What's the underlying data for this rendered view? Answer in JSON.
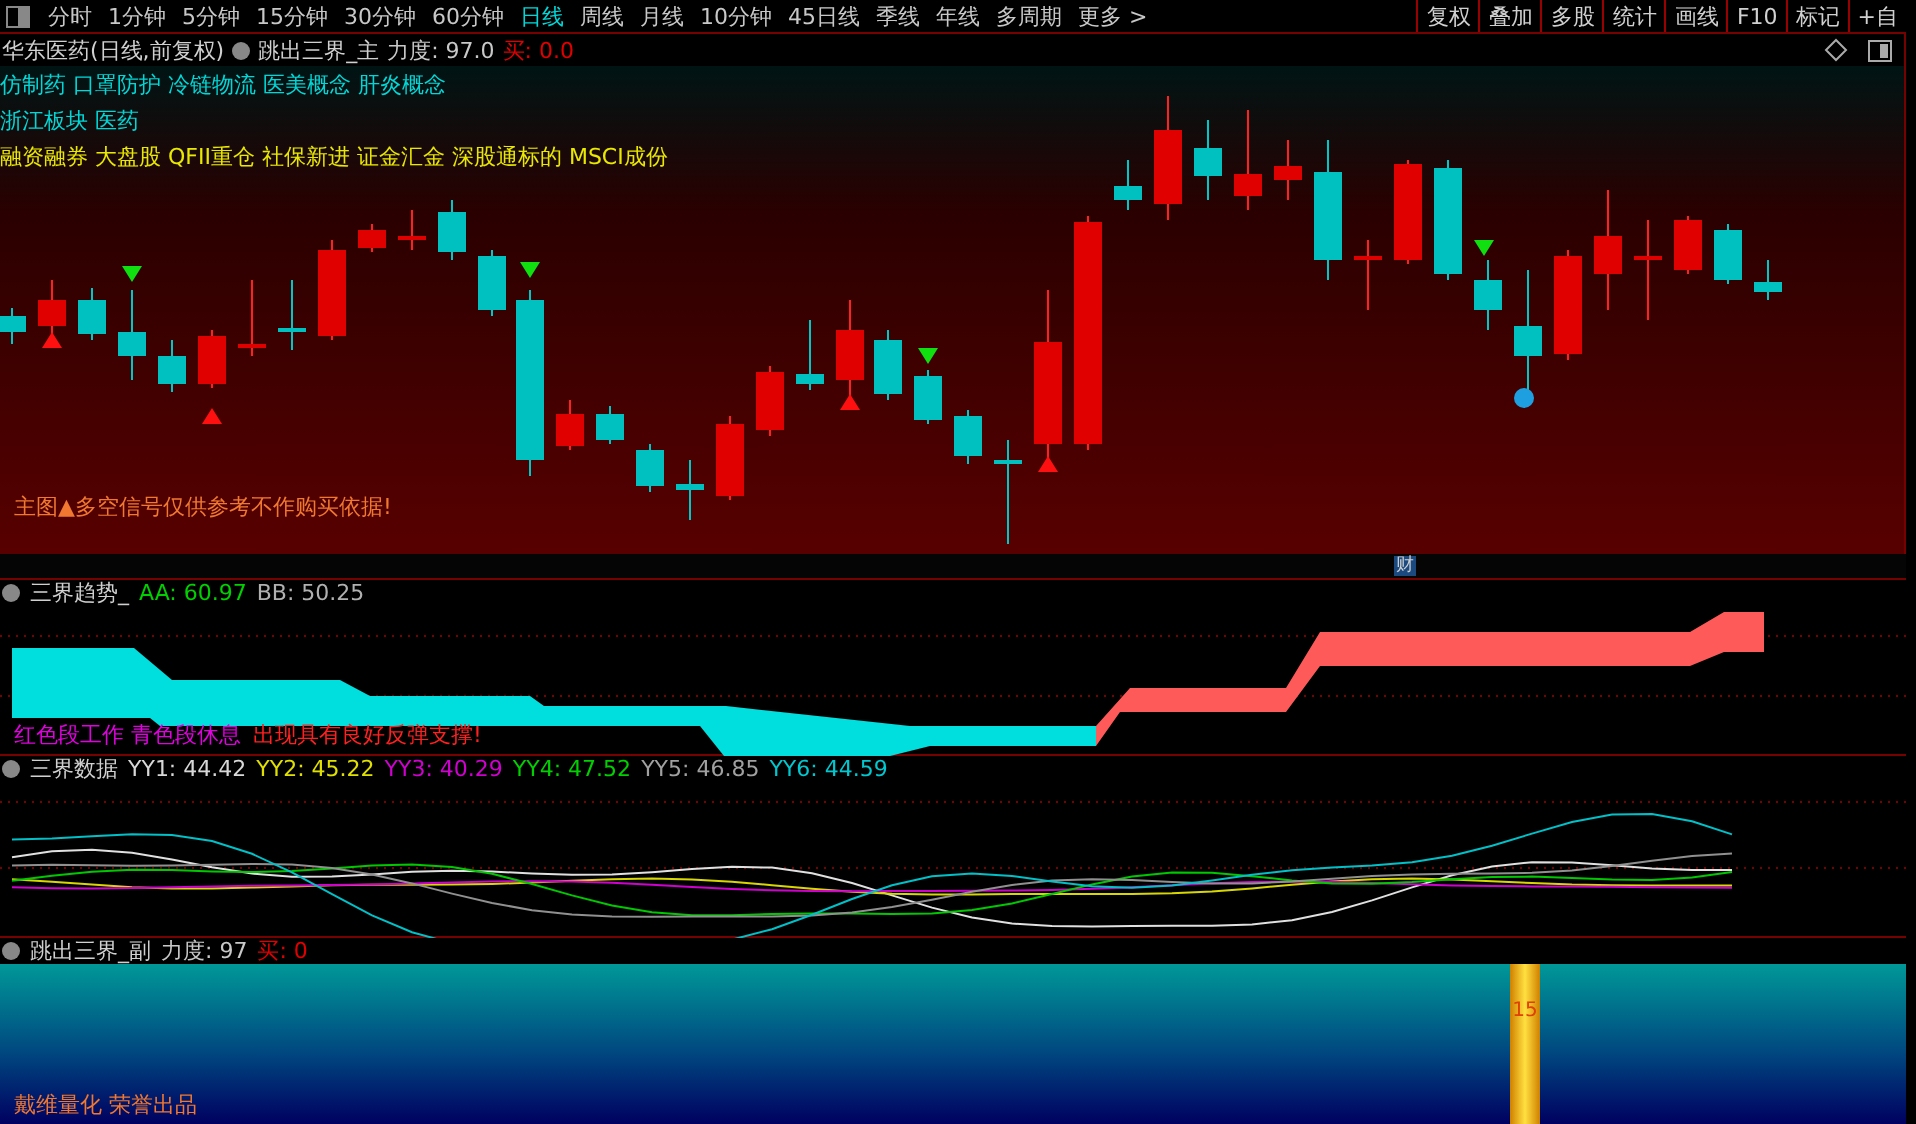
{
  "toolbar": {
    "periods": [
      {
        "label": "分时",
        "selected": false
      },
      {
        "label": "1分钟",
        "selected": false
      },
      {
        "label": "5分钟",
        "selected": false
      },
      {
        "label": "15分钟",
        "selected": false
      },
      {
        "label": "30分钟",
        "selected": false
      },
      {
        "label": "60分钟",
        "selected": false
      },
      {
        "label": "日线",
        "selected": true
      },
      {
        "label": "周线",
        "selected": false
      },
      {
        "label": "月线",
        "selected": false
      },
      {
        "label": "10分钟",
        "selected": false
      },
      {
        "label": "45日线",
        "selected": false
      },
      {
        "label": "季线",
        "selected": false
      },
      {
        "label": "年线",
        "selected": false
      },
      {
        "label": "多周期",
        "selected": false
      },
      {
        "label": "更多 >",
        "selected": false
      }
    ],
    "buttons": [
      "复权",
      "叠加",
      "多股",
      "统计",
      "画线",
      "F10",
      "标记",
      "+自"
    ]
  },
  "main_chart": {
    "title": "华东医药(日线,前复权)",
    "indicator": "跳出三界_主",
    "readouts": [
      {
        "text": "力度: 97.0",
        "color": "#c8c8c8"
      },
      {
        "text": "买: 0.0",
        "color": "#e00000"
      }
    ],
    "tag_lines": [
      {
        "text": "仿制药 口罩防护 冷链物流 医美概念 肝炎概念",
        "color": "#00d8d8"
      },
      {
        "text": "浙江板块  医药",
        "color": "#00d8d8"
      },
      {
        "text": "融资融券 大盘股 QFII重仓 社保新进 证金汇金 深股通标的 MSCI成份",
        "color": "#e8e800"
      }
    ],
    "note": "主图▲多空信号仅供参考不作购买依据!",
    "badge": "财"
  },
  "trend_panel": {
    "indicator": "三界趋势_",
    "readouts": [
      {
        "text": "AA: 60.97",
        "color": "#00d000"
      },
      {
        "text": "BB: 50.25",
        "color": "#b0b0b0"
      }
    ],
    "notes": [
      {
        "text": "红色段工作 青色段休息",
        "color": "#e000e0"
      },
      {
        "text": "出现具有良好反弹支撑!",
        "color": "#ff2020"
      }
    ]
  },
  "data_panel": {
    "indicator": "三界数据",
    "readouts": [
      {
        "text": "YY1: 44.42",
        "color": "#d8d8d8"
      },
      {
        "text": "YY2: 45.22",
        "color": "#e0e000"
      },
      {
        "text": "YY3: 40.29",
        "color": "#d000d0"
      },
      {
        "text": "YY4: 47.52",
        "color": "#00d000"
      },
      {
        "text": "YY5: 46.85",
        "color": "#a0a0a0"
      },
      {
        "text": "YY6: 44.59",
        "color": "#00c8d0"
      }
    ]
  },
  "sub_panel": {
    "indicator": "跳出三界_副",
    "readouts": [
      {
        "text": "力度: 97",
        "color": "#c8c8c8"
      },
      {
        "text": "买: 0",
        "color": "#e00000"
      }
    ],
    "bar_label": "15",
    "footer": "戴维量化 荣誉出品"
  }
}
